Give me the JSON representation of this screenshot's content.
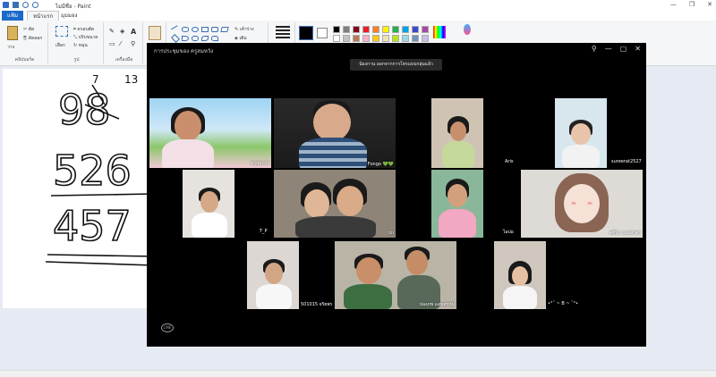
{
  "paint": {
    "window_title": "ไม่มีชื่อ - Paint",
    "tabs": {
      "file": "แฟ้ม",
      "home": "หน้าแรก",
      "view": "มุมมอง"
    },
    "ribbon": {
      "clipboard_label": "คลิปบอร์ด",
      "paste": "วาง",
      "cut": "ตัด",
      "copy": "คัดลอก",
      "image_label": "รูป",
      "select": "เลือก",
      "crop": "ครอบตัด",
      "resize": "ปรับขนาด",
      "rotate": "หมุน",
      "tools_label": "เครื่องมือ",
      "outline": "เค้าร่าง",
      "fill": "เติม"
    },
    "canvas_numbers": [
      "98",
      "526",
      "457"
    ],
    "canvas_carry": [
      "7",
      "13"
    ]
  },
  "meeting": {
    "title": "การประชุมของ ครูสมหวัง",
    "banner": "น้องกาน ออกจากการโทรแบบกลุ่มแล้ว",
    "participants": [
      {
        "name": "ครูสมหวัง"
      },
      {
        "name": "Fongo 💚💚"
      },
      {
        "name": "Aris"
      },
      {
        "name": "sureerat2527"
      },
      {
        "name": "T_P"
      },
      {
        "name": "ปก"
      },
      {
        "name": "ไอปอ"
      },
      {
        "name": "ศศินา แดงสาคร"
      },
      {
        "name": "501015 จริยพร"
      },
      {
        "name": "ปองภพ แสนพรหม"
      },
      {
        "name": "•°˜ ~ B ~ ˜°•"
      }
    ]
  },
  "colors": {
    "accent": "#1b6ac9",
    "palette": [
      "#000000",
      "#7f7f7f",
      "#880015",
      "#ed1c24",
      "#ff7f27",
      "#fff200",
      "#22b14c",
      "#00a2e8",
      "#3f48cc",
      "#a349a4",
      "#ffffff",
      "#c3c3c3",
      "#b97a57",
      "#ffaec9",
      "#ffc90e",
      "#efe4b0",
      "#b5e61d",
      "#99d9ea",
      "#7092be",
      "#c8bfe7"
    ]
  }
}
